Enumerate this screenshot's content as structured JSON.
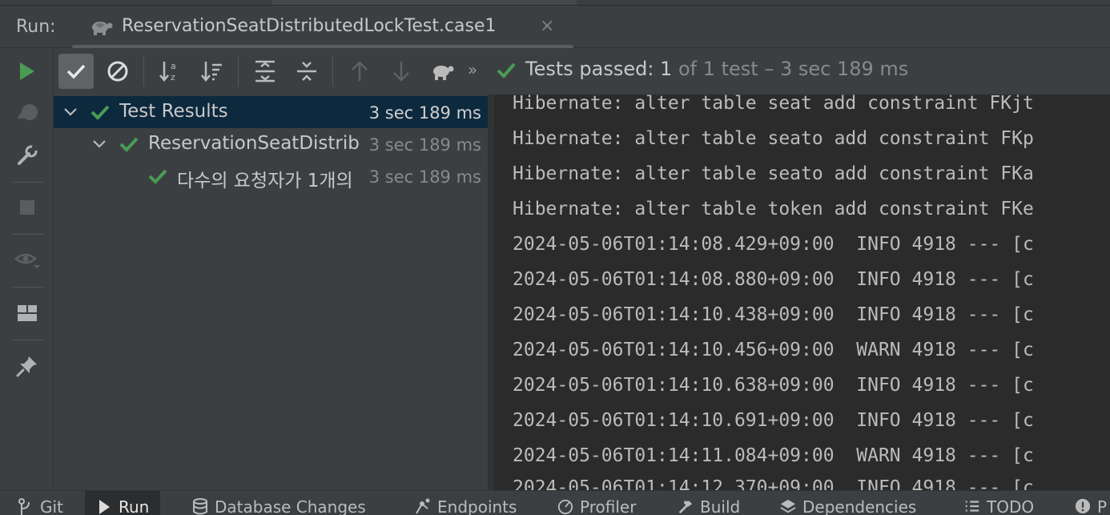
{
  "run_header": {
    "label": "Run:",
    "tab_title": "ReservationSeatDistributedLockTest.case1",
    "close_glyph": "×"
  },
  "toolbar": {
    "more_glyph": "»",
    "status_passed": "Tests passed: 1",
    "status_extra": " of 1 test – 3 sec 189 ms",
    "accent": "#499c54"
  },
  "tree": {
    "items": [
      {
        "label": "Test Results",
        "time": "3 sec 189 ms"
      },
      {
        "label": "ReservationSeatDistrib",
        "time": "3 sec 189 ms"
      },
      {
        "label": "다수의 요청자가 1개의",
        "time": "3 sec 189 ms"
      }
    ]
  },
  "console": {
    "lines": [
      "Hibernate: alter table seat add constraint FKjt",
      "Hibernate: alter table seato add constraint FKp",
      "Hibernate: alter table seato add constraint FKa",
      "Hibernate: alter table token add constraint FKe",
      "2024-05-06T01:14:08.429+09:00  INFO 4918 --- [c",
      "2024-05-06T01:14:08.880+09:00  INFO 4918 --- [c",
      "2024-05-06T01:14:10.438+09:00  INFO 4918 --- [c",
      "2024-05-06T01:14:10.456+09:00  WARN 4918 --- [c",
      "2024-05-06T01:14:10.638+09:00  INFO 4918 --- [c",
      "2024-05-06T01:14:10.691+09:00  INFO 4918 --- [c",
      "2024-05-06T01:14:11.084+09:00  WARN 4918 --- [c",
      "2024-05-06T01:14:12.370+09:00  INFO 4918 --- [c"
    ]
  },
  "bottom_bar": {
    "git": "Git",
    "run": "Run",
    "database_changes": "Database Changes",
    "endpoints": "Endpoints",
    "profiler": "Profiler",
    "build": "Build",
    "dependencies": "Dependencies",
    "todo": "TODO",
    "problems": "P"
  }
}
